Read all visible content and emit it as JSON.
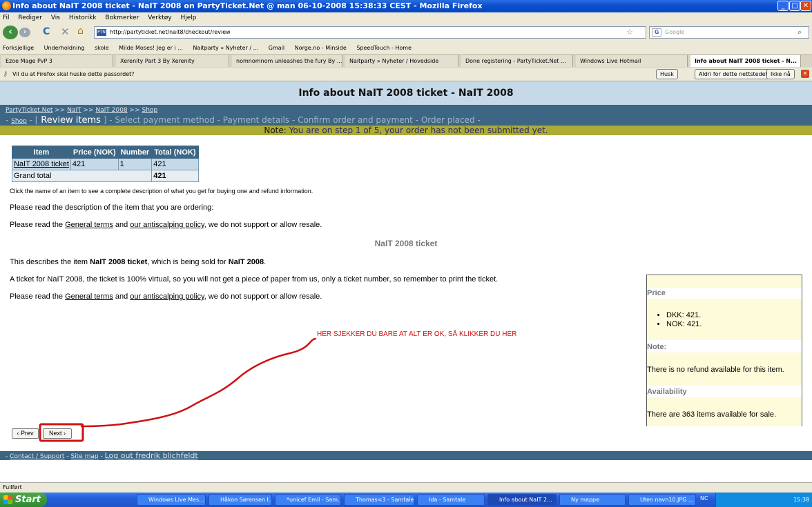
{
  "window": {
    "title": "Info about NaIT 2008 ticket - NaIT 2008 on PartyTicket.Net @ man 06-10-2008 15:38:33 CEST - Mozilla Firefox"
  },
  "menu": [
    "Fil",
    "Rediger",
    "Vis",
    "Historikk",
    "Bokmerker",
    "Verktøy",
    "Hjelp"
  ],
  "navbar": {
    "url": "http://partyticket.net/nait8/checkout/review",
    "favicon_text": "PTN",
    "search_placeholder": "Google"
  },
  "bookmarks": [
    "Forksjellige",
    "Underholdning",
    "skole",
    "Milde Moses! Jeg er i ...",
    "Naitparty » Nyheter / ...",
    "Gmail",
    "Norge.no - Minside",
    "SpeedTouch - Home"
  ],
  "tabs": [
    {
      "label": "Ezoe Mage PvP 3",
      "active": false
    },
    {
      "label": "Xerenity Part 3 By Xerenity",
      "active": false
    },
    {
      "label": "nomnomnom unleashes the fury By ...",
      "active": false
    },
    {
      "label": "Naitparty » Nyheter / Hovedside",
      "active": false
    },
    {
      "label": "Done registering - PartyTicket.Net ...",
      "active": false
    },
    {
      "label": "Windows Live Hotmail",
      "active": false
    },
    {
      "label": "Info about NaIT 2008 ticket - N...",
      "active": true
    }
  ],
  "password_bar": {
    "text": "Vil du at Firefox skal huske dette passordet?",
    "remember": "Husk",
    "never": "Aldri for dette nettstedet",
    "not_now": "Ikke nå"
  },
  "page": {
    "header": "Info about NaIT 2008 ticket - NaIT 2008",
    "breadcrumb": [
      "PartyTicket.Net",
      "NaIT",
      "NaIT 2008",
      "Shop"
    ],
    "breadcrumb_sep": ">>",
    "steps": {
      "shop": "Shop",
      "current": "Review items",
      "rest": "- Select payment method - Payment details - Confirm order and payment - Order placed -"
    },
    "note_label": "Note:",
    "note_text": "You are on step 1 of 5, your order has not been submitted yet.",
    "table": {
      "headers": [
        "Item",
        "Price (NOK)",
        "Number",
        "Total (NOK)"
      ],
      "row": {
        "item": "NaIT 2008 ticket",
        "price": "421",
        "number": "1",
        "total": "421"
      },
      "grand_label": "Grand total",
      "grand_value": "421"
    },
    "click_hint": "Click the name of an item to see a complete description of what you get for buying one and refund information.",
    "read_desc": "Please read the description of the item that you are ordering:",
    "read_terms": {
      "pre": "Please read the ",
      "terms": "General terms",
      "and": " and ",
      "policy": "our antiscalping policy",
      "post": ", we do not support or allow resale."
    },
    "item_title": "NaIT 2008 ticket",
    "describes": {
      "pre": "This describes the item ",
      "item": "NaIT 2008 ticket",
      "mid": ", which is being sold for ",
      "event": "NaIT 2008",
      "post": "."
    },
    "virtual_text": "A ticket for NaIT 2008, the ticket is 100% virtual, so you will not get a piece of paper from us, only a ticket number, so remember to print the ticket.",
    "infobox": {
      "price_heading": "Price",
      "prices": [
        "DKK: 421.",
        "NOK: 421."
      ],
      "note_heading": "Note:",
      "note_text": "There is no refund available for this item.",
      "avail_heading": "Availability",
      "avail_text": "There are 363 items available for sale."
    },
    "annotation": "HER SJEKKER DU BARE AT ALT ER OK, SÅ KLIKKER DU HER",
    "prev_button": "‹ Prev",
    "next_button": "Next ›",
    "footer": {
      "contact": "Contact / Support",
      "sitemap": "Site map",
      "logout": "Log out fredrik blichfeldt"
    }
  },
  "status": "Fullført",
  "taskbar": {
    "start": "Start",
    "items": [
      "Windows Live Mes...",
      "Håkon Sørensen I...",
      "*unicef Emil - Sam...",
      "Thomas<3 - Samtale",
      "Ida - Samtale",
      "Info about NaIT 2...",
      "Ny mappe",
      "Uten navn10.JPG ..."
    ],
    "active_index": 5,
    "lang": "NC",
    "clock": "15:38"
  },
  "colors": {
    "annotation": "#d01010",
    "site_bar": "#3d6685",
    "note_bar": "#adab33"
  }
}
